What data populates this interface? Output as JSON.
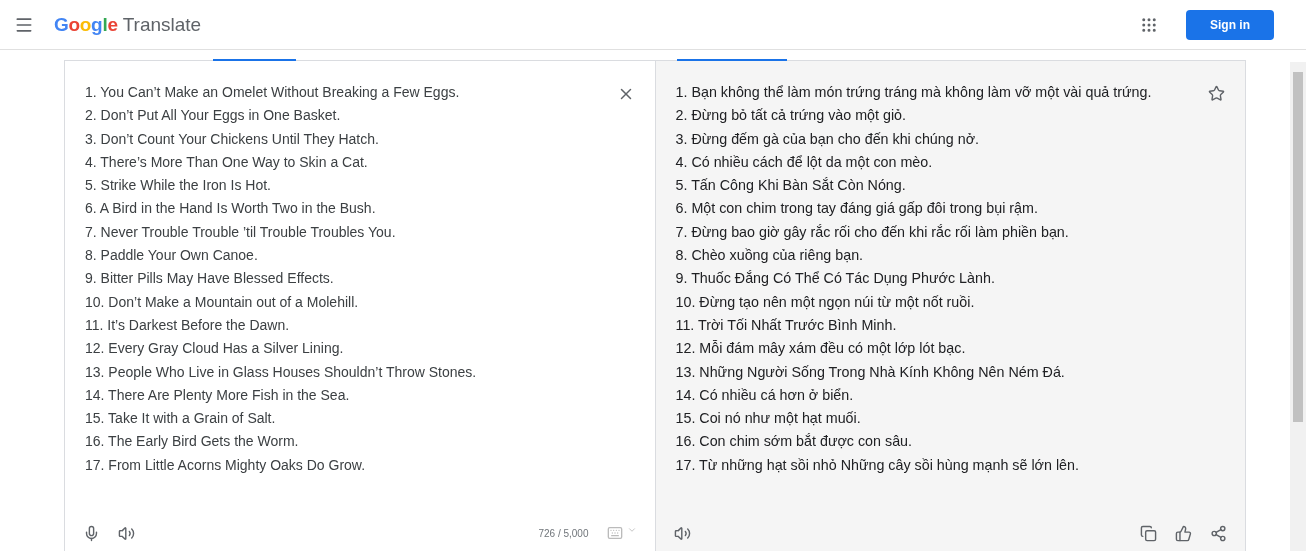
{
  "header": {
    "logo": "Google",
    "product": "Translate",
    "sign_in": "Sign in"
  },
  "source": {
    "lines": [
      "1. You Can’t Make an Omelet Without Breaking a Few Eggs.",
      "2. Don’t Put All Your Eggs in One Basket.",
      "3. Don’t Count Your Chickens Until They Hatch.",
      "4. There’s More Than One Way to Skin a Cat.",
      "5. Strike While the Iron Is Hot.",
      "6. A Bird in the Hand Is Worth Two in the Bush.",
      "7. Never Trouble Trouble ’til Trouble Troubles You.",
      "8. Paddle Your Own Canoe.",
      "9. Bitter Pills May Have Blessed Effects.",
      "10. Don’t Make a Mountain out of a Molehill.",
      "11. It’s Darkest Before the Dawn.",
      "12. Every Gray Cloud Has a Silver Lining.",
      "13. People Who Live in Glass Houses Shouldn’t Throw Stones.",
      "14. There Are Plenty More Fish in the Sea.",
      "15. Take It with a Grain of Salt.",
      "16. The Early Bird Gets the Worm.",
      "17. From Little Acorns Mighty Oaks Do Grow."
    ],
    "char_count": "726 / 5,000"
  },
  "translation": {
    "lines": [
      "1. Bạn không thể làm món trứng tráng mà không làm vỡ một vài quả trứng.",
      "2. Đừng bỏ tất cả trứng vào một giỏ.",
      "3. Đừng đếm gà của bạn cho đến khi chúng nở.",
      "4. Có nhiều cách để lột da một con mèo.",
      "5. Tấn Công Khi Bàn Sắt Còn Nóng.",
      "6. Một con chim trong tay đáng giá gấp đôi trong bụi rậm.",
      "7. Đừng bao giờ gây rắc rối cho đến khi rắc rối làm phiền bạn.",
      "8. Chèo xuồng của riêng bạn.",
      "9. Thuốc Đắng Có Thể Có Tác Dụng Phước Lành.",
      "10. Đừng tạo nên một ngọn núi từ một nốt ruồi.",
      "11. Trời Tối Nhất Trước Bình Minh.",
      "12. Mỗi đám mây xám đều có một lớp lót bạc.",
      "13. Những Người Sống Trong Nhà Kính Không Nên Ném Đá.",
      "14. Có nhiều cá hơn ở biển.",
      "15. Coi nó như một hạt muối.",
      "16. Con chim sớm bắt được con sâu.",
      "17. Từ những hạt sồi nhỏ Những cây sồi hùng mạnh sẽ lớn lên."
    ]
  }
}
